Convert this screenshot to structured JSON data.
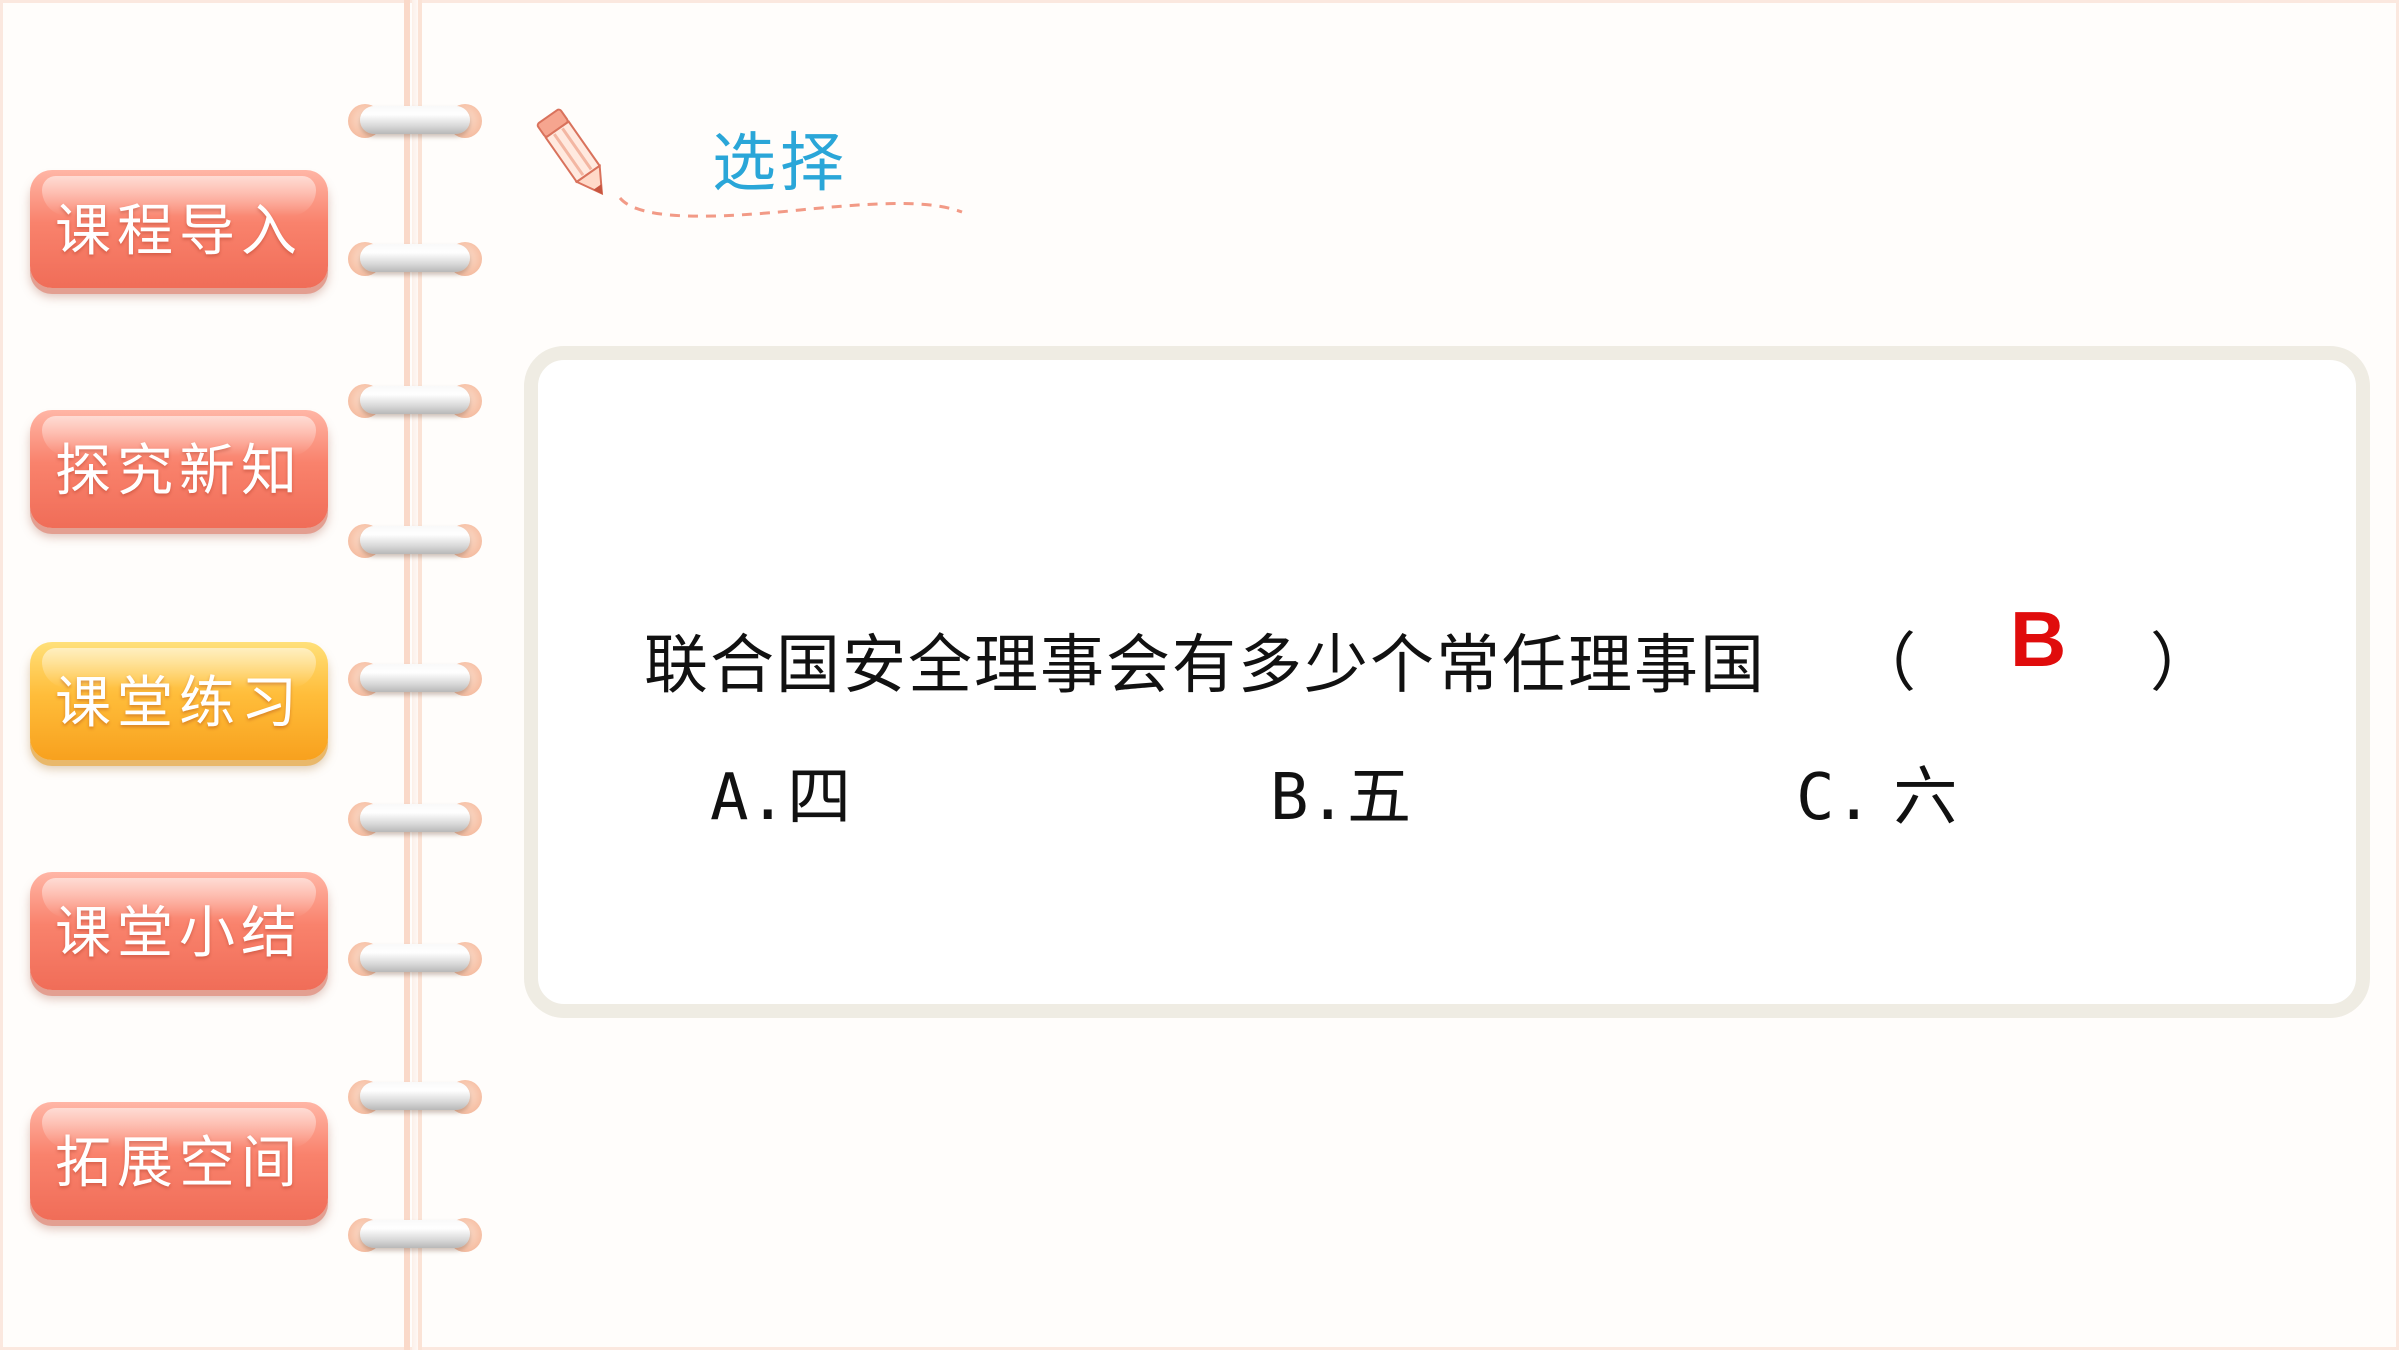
{
  "sidebar": {
    "items": [
      {
        "label": "课程导入",
        "active": false
      },
      {
        "label": "探究新知",
        "active": false
      },
      {
        "label": "课堂练习",
        "active": true
      },
      {
        "label": "课堂小结",
        "active": false
      },
      {
        "label": "拓展空间",
        "active": false
      }
    ]
  },
  "header": {
    "title": "选择",
    "icon": "pencil-icon"
  },
  "question": {
    "text": "联合国安全理事会有多少个常任理事国",
    "paren_open": "（",
    "answer": "B",
    "paren_close": "）",
    "options": [
      {
        "letter": "A.",
        "text": "四"
      },
      {
        "letter": "B.",
        "text": "五"
      },
      {
        "letter": "C.",
        "text": " 六"
      }
    ]
  },
  "colors": {
    "nav_default": "#f7806a",
    "nav_active": "#fbb42e",
    "title": "#2aa6d8",
    "answer": "#e00c0c",
    "card_border": "#efece3"
  }
}
